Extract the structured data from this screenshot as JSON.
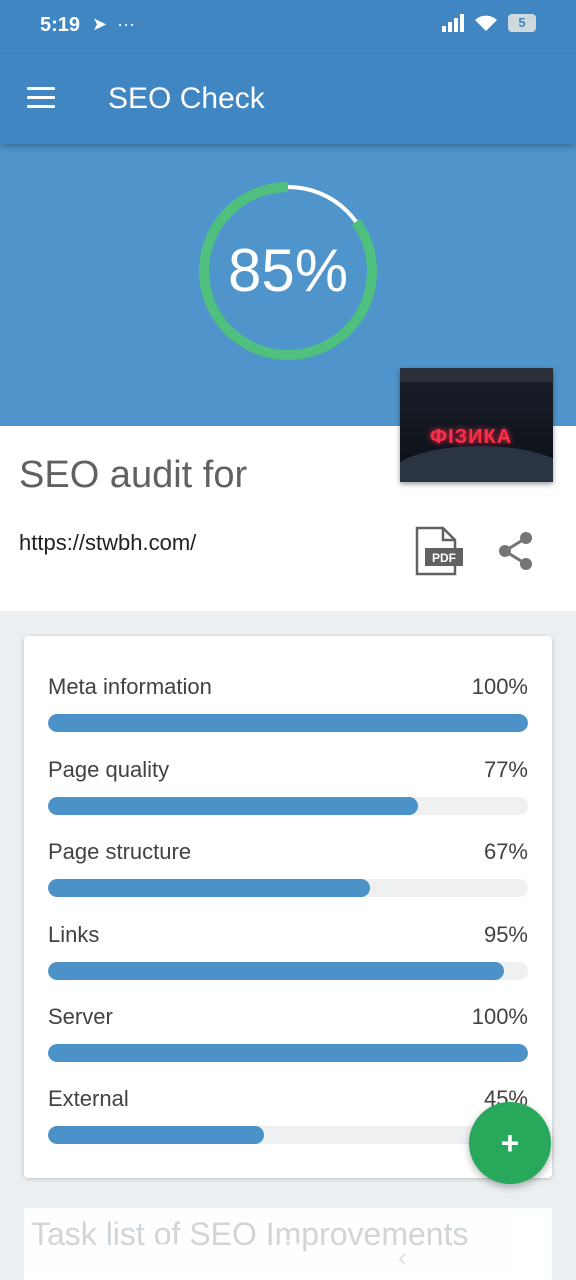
{
  "status_bar": {
    "time": "5:19",
    "left_icons": [
      "telegram-icon",
      "more-icon"
    ],
    "right_icons": [
      "signal-icon",
      "wifi-icon",
      "battery-icon"
    ],
    "battery_level": "5"
  },
  "app_bar": {
    "title": "SEO Check",
    "menu_icon": "menu-icon"
  },
  "hero": {
    "score_text": "85%",
    "score_value": 85,
    "ring_color": "#4fc07e"
  },
  "audit": {
    "heading": "SEO audit for",
    "url": "https://stwbh.com/",
    "pdf_label": "PDF",
    "thumbnail_text": "ФІЗИКА"
  },
  "categories": [
    {
      "label": "Meta information",
      "value_text": "100%",
      "value": 100
    },
    {
      "label": "Page quality",
      "value_text": "77%",
      "value": 77
    },
    {
      "label": "Page structure",
      "value_text": "67%",
      "value": 67
    },
    {
      "label": "Links",
      "value_text": "95%",
      "value": 95
    },
    {
      "label": "Server",
      "value_text": "100%",
      "value": 100
    },
    {
      "label": "External",
      "value_text": "45%",
      "value": 45
    }
  ],
  "fab": {
    "label": "+"
  },
  "task_list": {
    "title": "Task list of SEO Improvements"
  },
  "colors": {
    "primary": "#3f86c2",
    "hero": "#4f95cc",
    "bar": "#4b92c9",
    "fab": "#27a85a"
  }
}
